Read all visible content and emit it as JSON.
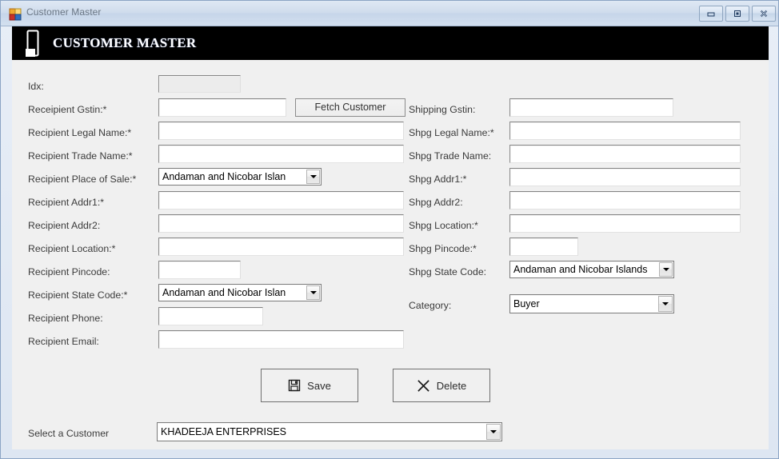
{
  "window": {
    "title": "Customer Master",
    "icon": "vb-form-icon",
    "controls": [
      {
        "name": "minimize-button",
        "icon": "minimize-icon"
      },
      {
        "name": "maximize-button",
        "icon": "maximize-icon"
      },
      {
        "name": "close-button",
        "icon": "close-icon"
      }
    ]
  },
  "banner": {
    "title": "CUSTOMER MASTER",
    "icon": "document-card-icon",
    "background": "#000000",
    "text_color": "#ffffff"
  },
  "form": {
    "left_fields": [
      {
        "label": "Idx:",
        "type": "textbox",
        "value": "",
        "disabled": true
      },
      {
        "label": "Receipient Gstin:*",
        "type": "textbox",
        "value": ""
      },
      {
        "label": "Recipient Legal Name:*",
        "type": "textbox",
        "value": ""
      },
      {
        "label": "Recipient Trade Name:*",
        "type": "textbox",
        "value": ""
      },
      {
        "label": "Recipient Place of Sale:*",
        "type": "combo",
        "value": "Andaman and Nicobar Islan"
      },
      {
        "label": "Recipient  Addr1:*",
        "type": "textbox",
        "value": ""
      },
      {
        "label": "Recipient Addr2:",
        "type": "textbox",
        "value": ""
      },
      {
        "label": "Recipient Location:*",
        "type": "textbox",
        "value": ""
      },
      {
        "label": "Recipient Pincode:",
        "type": "textbox",
        "value": ""
      },
      {
        "label": "Recipient State Code:*",
        "type": "combo",
        "value": "Andaman and Nicobar Islan"
      },
      {
        "label": "Recipient  Phone:",
        "type": "textbox",
        "value": ""
      },
      {
        "label": "Recipient Email:",
        "type": "textbox",
        "value": ""
      }
    ],
    "right_fields": [
      {
        "label": "Shipping Gstin:",
        "type": "textbox",
        "value": ""
      },
      {
        "label": "Shpg Legal Name:*",
        "type": "textbox",
        "value": ""
      },
      {
        "label": "Shpg Trade Name:",
        "type": "textbox",
        "value": ""
      },
      {
        "label": "Shpg Addr1:*",
        "type": "textbox",
        "value": ""
      },
      {
        "label": "Shpg Addr2:",
        "type": "textbox",
        "value": ""
      },
      {
        "label": "Shpg Location:*",
        "type": "textbox",
        "value": ""
      },
      {
        "label": "Shpg Pincode:*",
        "type": "textbox",
        "value": ""
      },
      {
        "label": "Shpg State Code:",
        "type": "combo",
        "value": "Andaman and Nicobar Islands"
      },
      {
        "label": "Category:",
        "type": "combo",
        "value": "Buyer"
      }
    ],
    "fetch_button": {
      "label": "Fetch Customer"
    },
    "save_button": {
      "label": "Save",
      "icon": "floppy-disk-icon"
    },
    "delete_button": {
      "label": "Delete",
      "icon": "x-cross-icon"
    },
    "customer_selector": {
      "label": "Select a Customer",
      "value": "KHADEEJA ENTERPRISES"
    }
  }
}
